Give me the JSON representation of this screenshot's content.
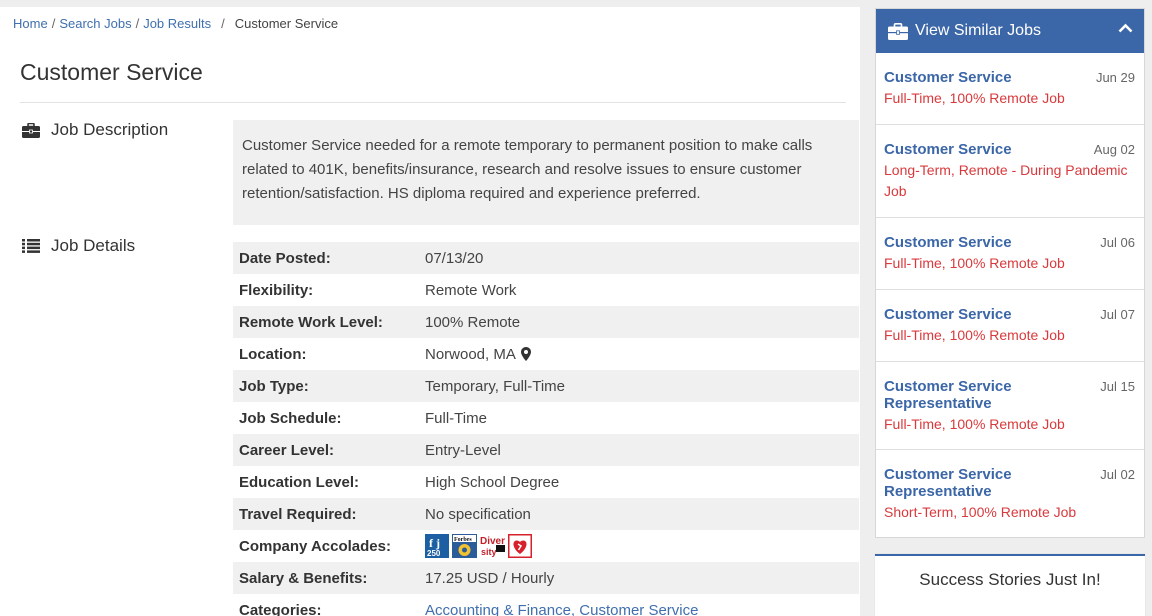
{
  "breadcrumb": {
    "home": "Home",
    "search_jobs": "Search Jobs",
    "job_results": "Job Results",
    "current": "Customer Service",
    "sep": "/"
  },
  "page": {
    "title": "Customer Service"
  },
  "description": {
    "label": "Job Description",
    "text": "Customer Service needed for a remote temporary to permanent position to make calls related to 401K, benefits/insurance, research and resolve issues to ensure customer retention/satisfaction. HS diploma required and experience preferred."
  },
  "details": {
    "label": "Job Details",
    "rows": [
      {
        "label": "Date Posted:",
        "value": "07/13/20"
      },
      {
        "label": "Flexibility:",
        "value": "Remote Work"
      },
      {
        "label": "Remote Work Level:",
        "value": "100% Remote"
      },
      {
        "label": "Location:",
        "value": "Norwood, MA"
      },
      {
        "label": "Job Type:",
        "value": "Temporary, Full-Time"
      },
      {
        "label": "Job Schedule:",
        "value": "Full-Time"
      },
      {
        "label": "Career Level:",
        "value": "Entry-Level"
      },
      {
        "label": "Education Level:",
        "value": "High School Degree"
      },
      {
        "label": "Travel Required:",
        "value": "No specification"
      },
      {
        "label": "Company Accolades:",
        "value": ""
      },
      {
        "label": "Salary & Benefits:",
        "value": "17.25 USD / Hourly"
      },
      {
        "label": "Categories:",
        "value": ""
      }
    ],
    "categories": [
      "Accounting & Finance",
      "Customer Service"
    ],
    "accolades": [
      "fj-250-icon",
      "forbes-icon",
      "diversity-icon",
      "heart-icon"
    ]
  },
  "sidebar": {
    "title": "View Similar Jobs",
    "items": [
      {
        "title": "Customer Service",
        "date": "Jun 29",
        "sub": "Full-Time, 100% Remote Job"
      },
      {
        "title": "Customer Service",
        "date": "Aug 02",
        "sub": "Long-Term, Remote - During Pandemic Job"
      },
      {
        "title": "Customer Service",
        "date": "Jul 06",
        "sub": "Full-Time, 100% Remote Job"
      },
      {
        "title": "Customer Service",
        "date": "Jul 07",
        "sub": "Full-Time, 100% Remote Job"
      },
      {
        "title": "Customer Service Representative",
        "date": "Jul 15",
        "sub": "Full-Time, 100% Remote Job"
      },
      {
        "title": "Customer Service Representative",
        "date": "Jul 02",
        "sub": "Short-Term, 100% Remote Job"
      }
    ]
  },
  "success": {
    "title": "Success Stories Just In!"
  },
  "colors": {
    "brand": "#3b66a7",
    "link": "#3f6fae",
    "accent": "#d9393c"
  }
}
